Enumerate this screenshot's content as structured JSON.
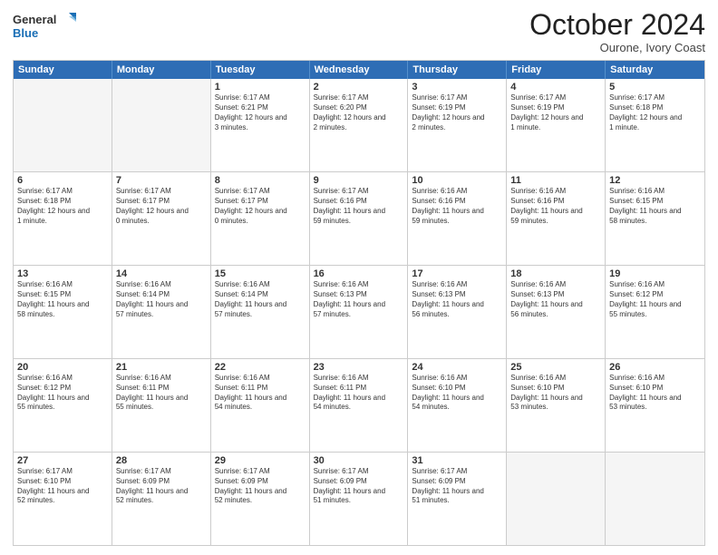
{
  "header": {
    "logo_line1": "General",
    "logo_line2": "Blue",
    "month": "October 2024",
    "location": "Ourone, Ivory Coast"
  },
  "days_of_week": [
    "Sunday",
    "Monday",
    "Tuesday",
    "Wednesday",
    "Thursday",
    "Friday",
    "Saturday"
  ],
  "weeks": [
    [
      {
        "day": "",
        "sunrise": "",
        "sunset": "",
        "daylight": ""
      },
      {
        "day": "",
        "sunrise": "",
        "sunset": "",
        "daylight": ""
      },
      {
        "day": "1",
        "sunrise": "Sunrise: 6:17 AM",
        "sunset": "Sunset: 6:21 PM",
        "daylight": "Daylight: 12 hours and 3 minutes."
      },
      {
        "day": "2",
        "sunrise": "Sunrise: 6:17 AM",
        "sunset": "Sunset: 6:20 PM",
        "daylight": "Daylight: 12 hours and 2 minutes."
      },
      {
        "day": "3",
        "sunrise": "Sunrise: 6:17 AM",
        "sunset": "Sunset: 6:19 PM",
        "daylight": "Daylight: 12 hours and 2 minutes."
      },
      {
        "day": "4",
        "sunrise": "Sunrise: 6:17 AM",
        "sunset": "Sunset: 6:19 PM",
        "daylight": "Daylight: 12 hours and 1 minute."
      },
      {
        "day": "5",
        "sunrise": "Sunrise: 6:17 AM",
        "sunset": "Sunset: 6:18 PM",
        "daylight": "Daylight: 12 hours and 1 minute."
      }
    ],
    [
      {
        "day": "6",
        "sunrise": "Sunrise: 6:17 AM",
        "sunset": "Sunset: 6:18 PM",
        "daylight": "Daylight: 12 hours and 1 minute."
      },
      {
        "day": "7",
        "sunrise": "Sunrise: 6:17 AM",
        "sunset": "Sunset: 6:17 PM",
        "daylight": "Daylight: 12 hours and 0 minutes."
      },
      {
        "day": "8",
        "sunrise": "Sunrise: 6:17 AM",
        "sunset": "Sunset: 6:17 PM",
        "daylight": "Daylight: 12 hours and 0 minutes."
      },
      {
        "day": "9",
        "sunrise": "Sunrise: 6:17 AM",
        "sunset": "Sunset: 6:16 PM",
        "daylight": "Daylight: 11 hours and 59 minutes."
      },
      {
        "day": "10",
        "sunrise": "Sunrise: 6:16 AM",
        "sunset": "Sunset: 6:16 PM",
        "daylight": "Daylight: 11 hours and 59 minutes."
      },
      {
        "day": "11",
        "sunrise": "Sunrise: 6:16 AM",
        "sunset": "Sunset: 6:16 PM",
        "daylight": "Daylight: 11 hours and 59 minutes."
      },
      {
        "day": "12",
        "sunrise": "Sunrise: 6:16 AM",
        "sunset": "Sunset: 6:15 PM",
        "daylight": "Daylight: 11 hours and 58 minutes."
      }
    ],
    [
      {
        "day": "13",
        "sunrise": "Sunrise: 6:16 AM",
        "sunset": "Sunset: 6:15 PM",
        "daylight": "Daylight: 11 hours and 58 minutes."
      },
      {
        "day": "14",
        "sunrise": "Sunrise: 6:16 AM",
        "sunset": "Sunset: 6:14 PM",
        "daylight": "Daylight: 11 hours and 57 minutes."
      },
      {
        "day": "15",
        "sunrise": "Sunrise: 6:16 AM",
        "sunset": "Sunset: 6:14 PM",
        "daylight": "Daylight: 11 hours and 57 minutes."
      },
      {
        "day": "16",
        "sunrise": "Sunrise: 6:16 AM",
        "sunset": "Sunset: 6:13 PM",
        "daylight": "Daylight: 11 hours and 57 minutes."
      },
      {
        "day": "17",
        "sunrise": "Sunrise: 6:16 AM",
        "sunset": "Sunset: 6:13 PM",
        "daylight": "Daylight: 11 hours and 56 minutes."
      },
      {
        "day": "18",
        "sunrise": "Sunrise: 6:16 AM",
        "sunset": "Sunset: 6:13 PM",
        "daylight": "Daylight: 11 hours and 56 minutes."
      },
      {
        "day": "19",
        "sunrise": "Sunrise: 6:16 AM",
        "sunset": "Sunset: 6:12 PM",
        "daylight": "Daylight: 11 hours and 55 minutes."
      }
    ],
    [
      {
        "day": "20",
        "sunrise": "Sunrise: 6:16 AM",
        "sunset": "Sunset: 6:12 PM",
        "daylight": "Daylight: 11 hours and 55 minutes."
      },
      {
        "day": "21",
        "sunrise": "Sunrise: 6:16 AM",
        "sunset": "Sunset: 6:11 PM",
        "daylight": "Daylight: 11 hours and 55 minutes."
      },
      {
        "day": "22",
        "sunrise": "Sunrise: 6:16 AM",
        "sunset": "Sunset: 6:11 PM",
        "daylight": "Daylight: 11 hours and 54 minutes."
      },
      {
        "day": "23",
        "sunrise": "Sunrise: 6:16 AM",
        "sunset": "Sunset: 6:11 PM",
        "daylight": "Daylight: 11 hours and 54 minutes."
      },
      {
        "day": "24",
        "sunrise": "Sunrise: 6:16 AM",
        "sunset": "Sunset: 6:10 PM",
        "daylight": "Daylight: 11 hours and 54 minutes."
      },
      {
        "day": "25",
        "sunrise": "Sunrise: 6:16 AM",
        "sunset": "Sunset: 6:10 PM",
        "daylight": "Daylight: 11 hours and 53 minutes."
      },
      {
        "day": "26",
        "sunrise": "Sunrise: 6:16 AM",
        "sunset": "Sunset: 6:10 PM",
        "daylight": "Daylight: 11 hours and 53 minutes."
      }
    ],
    [
      {
        "day": "27",
        "sunrise": "Sunrise: 6:17 AM",
        "sunset": "Sunset: 6:10 PM",
        "daylight": "Daylight: 11 hours and 52 minutes."
      },
      {
        "day": "28",
        "sunrise": "Sunrise: 6:17 AM",
        "sunset": "Sunset: 6:09 PM",
        "daylight": "Daylight: 11 hours and 52 minutes."
      },
      {
        "day": "29",
        "sunrise": "Sunrise: 6:17 AM",
        "sunset": "Sunset: 6:09 PM",
        "daylight": "Daylight: 11 hours and 52 minutes."
      },
      {
        "day": "30",
        "sunrise": "Sunrise: 6:17 AM",
        "sunset": "Sunset: 6:09 PM",
        "daylight": "Daylight: 11 hours and 51 minutes."
      },
      {
        "day": "31",
        "sunrise": "Sunrise: 6:17 AM",
        "sunset": "Sunset: 6:09 PM",
        "daylight": "Daylight: 11 hours and 51 minutes."
      },
      {
        "day": "",
        "sunrise": "",
        "sunset": "",
        "daylight": ""
      },
      {
        "day": "",
        "sunrise": "",
        "sunset": "",
        "daylight": ""
      }
    ]
  ]
}
